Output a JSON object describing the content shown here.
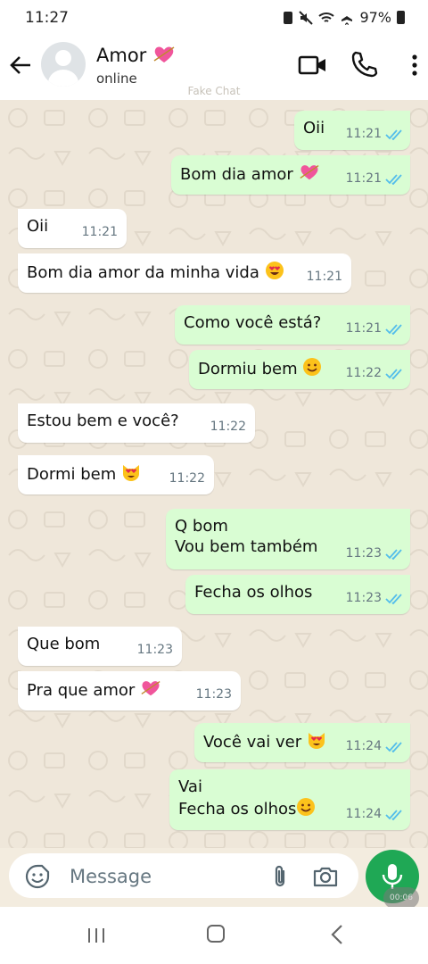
{
  "status_bar": {
    "time": "11:27",
    "battery": "97%"
  },
  "header": {
    "contact_name": "Amor",
    "contact_status": "online"
  },
  "watermark": "Fake Chat",
  "messages": [
    {
      "dir": "out",
      "text": "Oii",
      "time": "11:21"
    },
    {
      "dir": "out",
      "text": "Bom dia amor",
      "emoji": "heart-arrow",
      "time": "11:21"
    },
    {
      "dir": "in",
      "text": "Oii",
      "time": "11:21"
    },
    {
      "dir": "in",
      "text": "Bom dia amor da minha vida",
      "emoji": "heart-eyes",
      "time": "11:21"
    },
    {
      "dir": "out",
      "text": "Como você está?",
      "time": "11:21"
    },
    {
      "dir": "out",
      "text": "Dormiu bem",
      "emoji": "smile",
      "time": "11:22"
    },
    {
      "dir": "in",
      "text": "Estou bem e você?",
      "time": "11:22"
    },
    {
      "dir": "in",
      "text": "Dormi bem",
      "emoji": "heart-eyes-cat",
      "time": "11:22"
    },
    {
      "dir": "out",
      "text": "Q bom",
      "text2": "Vou bem também",
      "time": "11:23"
    },
    {
      "dir": "out",
      "text": "Fecha os olhos",
      "time": "11:23"
    },
    {
      "dir": "in",
      "text": "Que bom",
      "time": "11:23"
    },
    {
      "dir": "in",
      "text": "Pra que amor",
      "emoji": "heart-arrow",
      "time": "11:23"
    },
    {
      "dir": "out",
      "text": "Você vai ver",
      "emoji": "heart-eyes-cat",
      "time": "11:24"
    },
    {
      "dir": "out",
      "text": "Vai",
      "text2": "Fecha os olhos",
      "emoji": "smile",
      "time": "11:24"
    }
  ],
  "input": {
    "placeholder": "Message"
  },
  "mic_overlay": "00:06",
  "colors": {
    "outgoing": "#d9fdd3",
    "incoming": "#ffffff",
    "ticks": "#53bdeb",
    "mic": "#1fa855"
  },
  "icons": [
    "back-arrow-icon",
    "video-call-icon",
    "phone-icon",
    "more-vert-icon",
    "emoji-icon",
    "attach-icon",
    "camera-icon",
    "mic-icon"
  ]
}
